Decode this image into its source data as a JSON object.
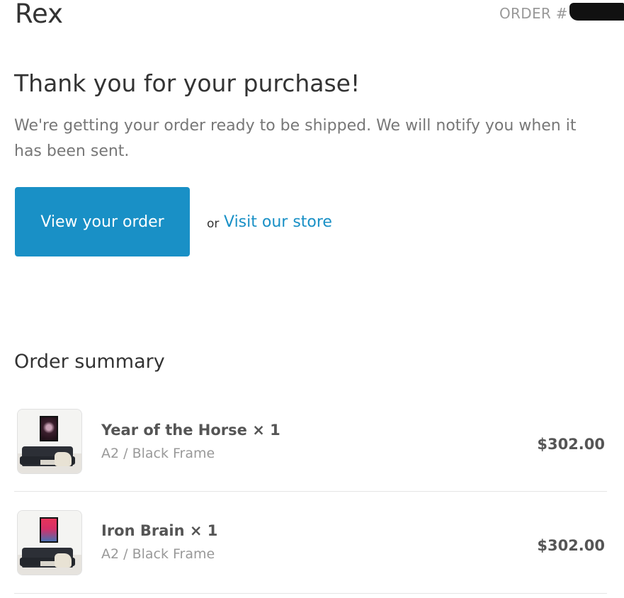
{
  "header": {
    "brand": "Rex",
    "order_label": "ORDER #"
  },
  "confirmation": {
    "title": "Thank you for your purchase!",
    "message": "We're getting your order ready to be shipped. We will notify you when it has been sent.",
    "primary_button": "View your order",
    "or_text": "or",
    "secondary_link": "Visit our store"
  },
  "summary": {
    "title": "Order summary",
    "items": [
      {
        "title": "Year of the Horse × 1",
        "variant": "A2 / Black Frame",
        "price": "$302.00",
        "art_color": "#6b4a5a"
      },
      {
        "title": "Iron Brain × 1",
        "variant": "A2 / Black Frame",
        "price": "$302.00",
        "art_color": "#e0375a"
      }
    ]
  },
  "colors": {
    "accent": "#1990c6",
    "text": "#333333",
    "muted": "#777777",
    "divider": "#e5e5e5"
  }
}
